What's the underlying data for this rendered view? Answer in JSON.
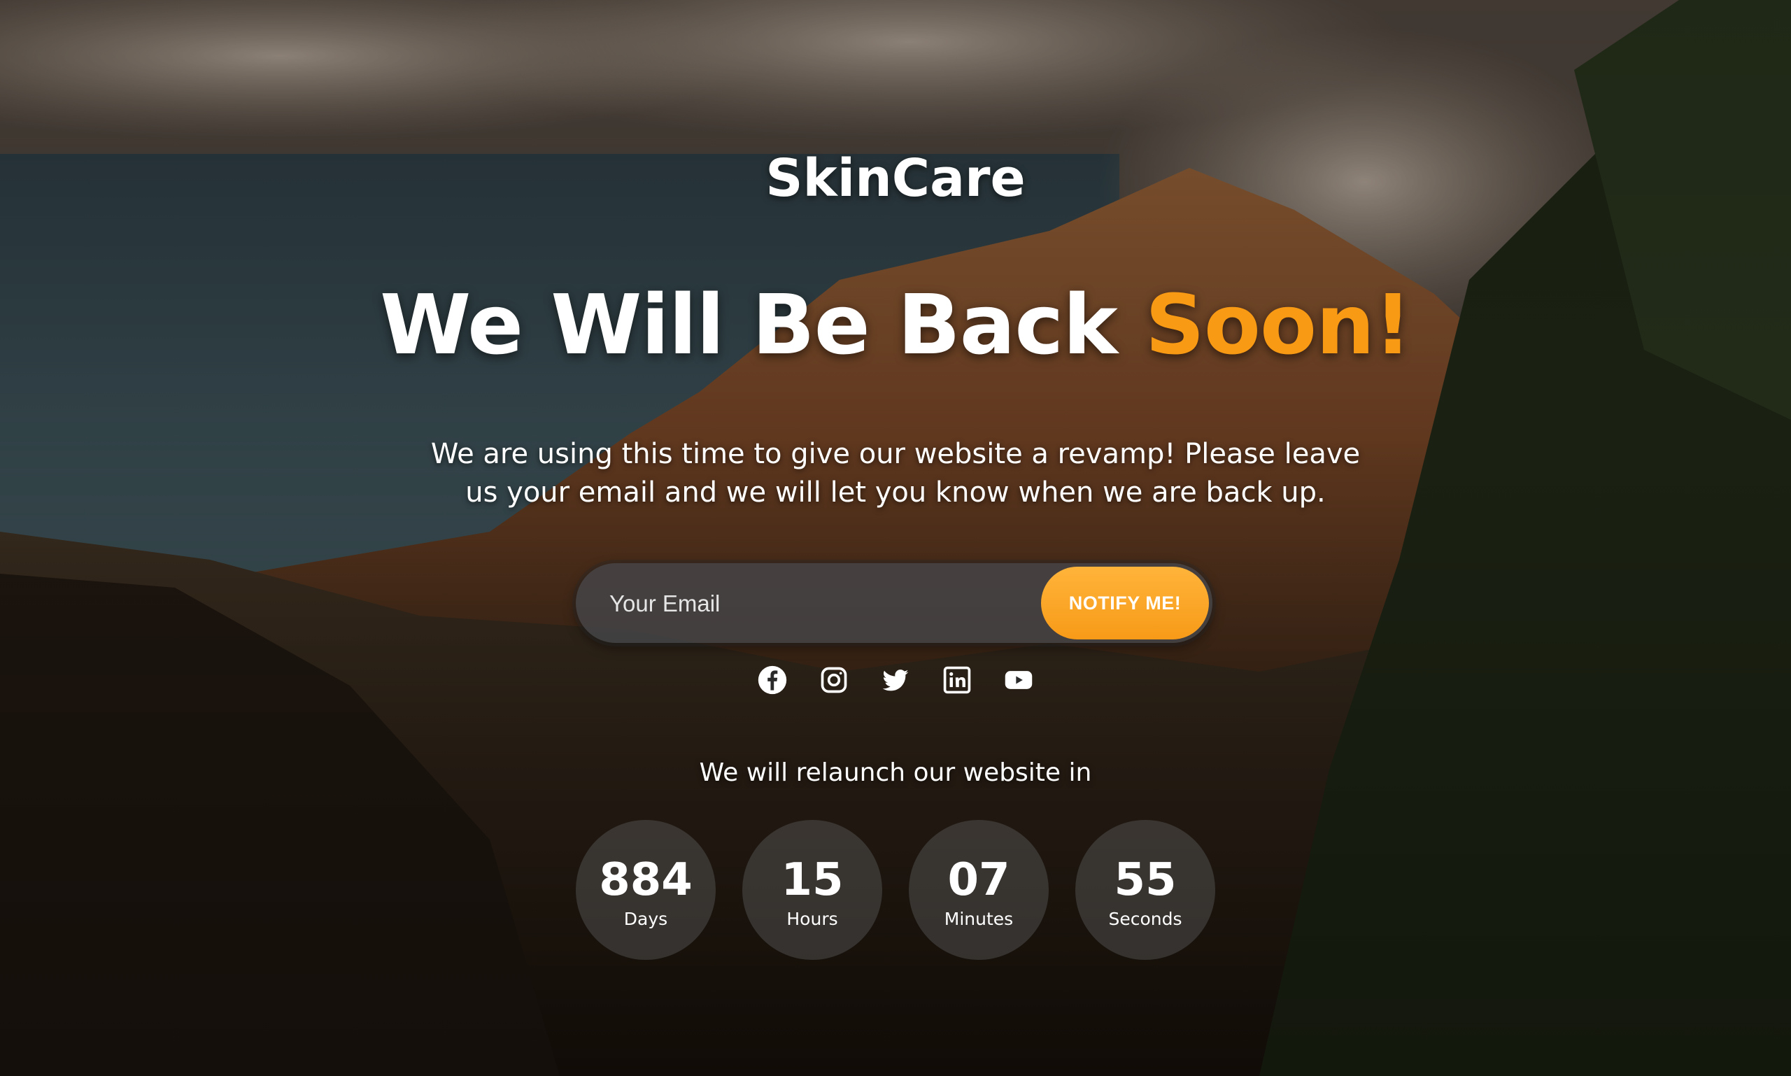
{
  "brand": {
    "name": "SkinCare"
  },
  "hero": {
    "headline_main": "We Will Be Back ",
    "headline_accent": "Soon!",
    "subtitle": "We are using this time to give our website a revamp! Please leave us your email and we will let you know when we are back up."
  },
  "form": {
    "email_placeholder": "Your Email",
    "email_value": "",
    "submit_label": "NOTIFY ME!"
  },
  "social": [
    {
      "name": "facebook-icon"
    },
    {
      "name": "instagram-icon"
    },
    {
      "name": "twitter-icon"
    },
    {
      "name": "linkedin-icon"
    },
    {
      "name": "youtube-icon"
    }
  ],
  "countdown": {
    "intro": "We will relaunch our website in",
    "units": [
      {
        "value": "884",
        "label": "Days"
      },
      {
        "value": "15",
        "label": "Hours"
      },
      {
        "value": "07",
        "label": "Minutes"
      },
      {
        "value": "55",
        "label": "Seconds"
      }
    ]
  },
  "colors": {
    "accent": "#f89a14",
    "text": "#ffffff"
  }
}
